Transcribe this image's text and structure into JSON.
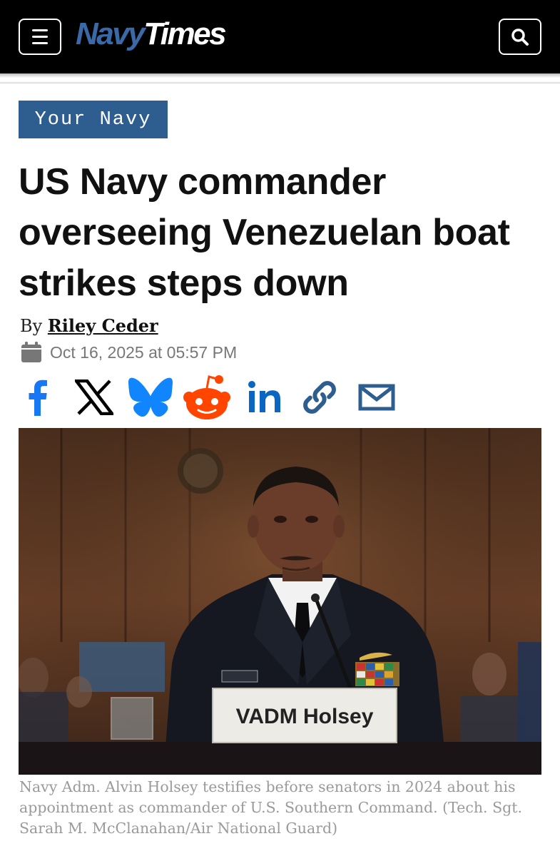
{
  "header": {
    "logo_part1": "Navy",
    "logo_part2": "Times",
    "menu_icon": "hamburger-menu-icon",
    "search_icon": "search-icon"
  },
  "article": {
    "section": "Your Navy",
    "headline": "US Navy commander overseeing Venezuelan boat strikes steps down",
    "byline_prefix": "By",
    "author": "Riley Ceder",
    "date": "Oct 16, 2025 at 05:57 PM",
    "date_icon": "calendar-icon"
  },
  "share": {
    "icons": [
      "facebook-icon",
      "x-icon",
      "bluesky-icon",
      "reddit-icon",
      "linkedin-icon",
      "link-icon",
      "email-icon"
    ],
    "colors": {
      "facebook": "#1877f2",
      "x": "#000000",
      "bluesky": "#1185fe",
      "reddit": "#ff4500",
      "linkedin": "#0a66c2",
      "link": "#2e5d8f",
      "email": "#2e5d8f"
    }
  },
  "photo": {
    "nameplate": "VADM Holsey"
  },
  "caption": "Navy Adm. Alvin Holsey testifies before senators in 2024 about his appointment as commander of U.S. Southern Command. (Tech. Sgt. Sarah M. McClanahan/Air National Guard)",
  "colors": {
    "header_bg": "#000000",
    "brand_blue": "#3a69a8",
    "section_tag_bg": "#2e5d8f",
    "caption_text": "#9a9a9a"
  }
}
